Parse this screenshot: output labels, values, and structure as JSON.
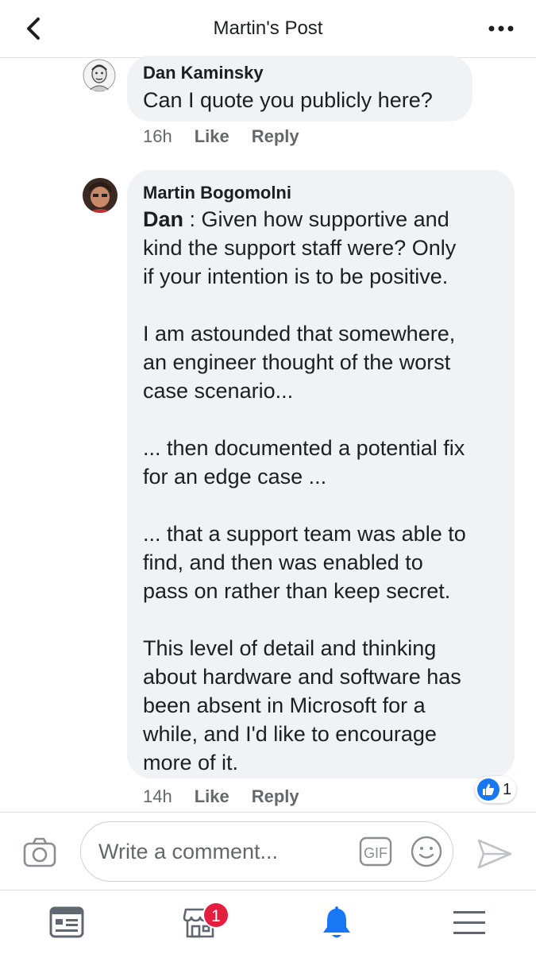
{
  "header": {
    "title": "Martin's Post"
  },
  "comments": [
    {
      "author": "Dan Kaminsky",
      "text": "Can I quote you publicly here?",
      "time": "16h",
      "like_label": "Like",
      "reply_label": "Reply"
    },
    {
      "author": "Martin Bogomolni",
      "mention": "Dan",
      "lines": [
        " : Given how supportive and",
        "kind the support staff were?  Only",
        "if your intention is to be positive.",
        "",
        "I am astounded that somewhere,",
        "an engineer thought of the worst",
        "case scenario...",
        "",
        "... then documented a potential fix",
        "for an edge case ...",
        "",
        "... that a support team was able to",
        "find, and then was enabled to",
        "pass on rather than keep secret.",
        "",
        "This level of detail and thinking",
        "about hardware and software has",
        "been absent in Microsoft for a",
        "while, and I'd like to encourage",
        "more of it."
      ],
      "time": "14h",
      "like_label": "Like",
      "reply_label": "Reply",
      "reaction_count": "1"
    }
  ],
  "composer": {
    "placeholder": "Write a comment...",
    "gif_label": "GIF"
  },
  "nav": {
    "badge": "1"
  },
  "colors": {
    "accent": "#1877f2",
    "bubble": "#f0f2f5",
    "badge": "#e41e3f",
    "muted": "#65676b"
  }
}
